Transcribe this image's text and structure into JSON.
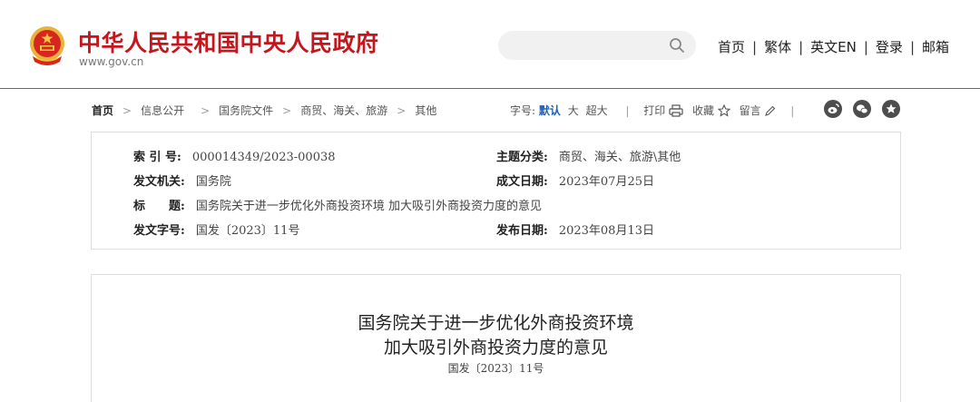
{
  "header": {
    "site_title": "中华人民共和国中央人民政府",
    "site_domain": "www.gov.cn",
    "search": {
      "placeholder": ""
    },
    "nav": [
      "首页",
      "繁体",
      "英文EN",
      "登录",
      "邮箱"
    ]
  },
  "breadcrumb": [
    "首页",
    "信息公开",
    "国务院文件",
    "商贸、海关、旅游",
    "其他"
  ],
  "toolbar": {
    "font_label": "字号:",
    "font_default": "默认",
    "font_large": "大",
    "font_xlarge": "超大",
    "print": "打印",
    "collect": "收藏",
    "comment": "留言"
  },
  "share_icons": [
    "weibo-icon",
    "wechat-icon",
    "favorite-icon"
  ],
  "info": {
    "index_label": "索 引 号:",
    "index_value": "000014349/2023-00038",
    "category_label": "主题分类:",
    "category_value": "商贸、海关、旅游\\其他",
    "issuer_label": "发文机关:",
    "issuer_value": "国务院",
    "written_label": "成文日期:",
    "written_value": "2023年07月25日",
    "title_label": "标　　题:",
    "title_value": "国务院关于进一步优化外商投资环境 加大吸引外商投资力度的意见",
    "docno_label": "发文字号:",
    "docno_value": "国发〔2023〕11号",
    "published_label": "发布日期:",
    "published_value": "2023年08月13日"
  },
  "document": {
    "title_line1": "国务院关于进一步优化外商投资环境",
    "title_line2": "加大吸引外商投资力度的意见",
    "doc_no": "国发〔2023〕11号"
  },
  "colors": {
    "brand_red": "#c4161c",
    "accent_blue": "#1a5fb4",
    "gold": "#e8b33a"
  }
}
